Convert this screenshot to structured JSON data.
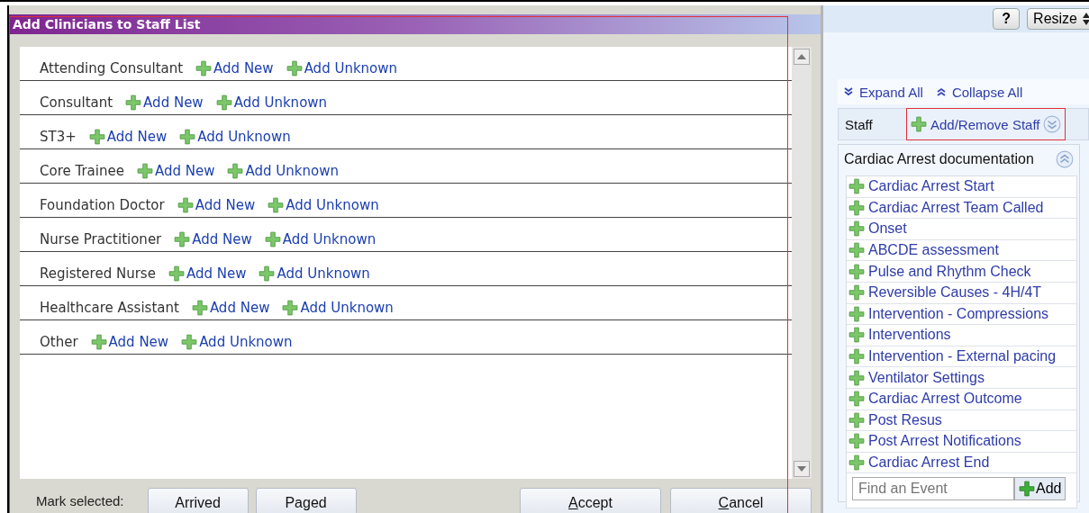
{
  "dialog": {
    "title": "Add Clinicians to Staff List",
    "roles": [
      {
        "label": "Attending Consultant",
        "actions": [
          "Add New",
          "Add Unknown"
        ]
      },
      {
        "label": "Consultant",
        "actions": [
          "Add New",
          "Add Unknown"
        ]
      },
      {
        "label": "ST3+",
        "actions": [
          "Add New",
          "Add Unknown"
        ]
      },
      {
        "label": "Core Trainee",
        "actions": [
          "Add New",
          "Add Unknown"
        ]
      },
      {
        "label": "Foundation Doctor",
        "actions": [
          "Add New",
          "Add Unknown"
        ]
      },
      {
        "label": "Nurse Practitioner",
        "actions": [
          "Add New",
          "Add Unknown"
        ]
      },
      {
        "label": "Registered Nurse",
        "actions": [
          "Add New",
          "Add Unknown"
        ]
      },
      {
        "label": "Healthcare Assistant",
        "actions": [
          "Add New",
          "Add Unknown"
        ]
      },
      {
        "label": "Other",
        "actions": [
          "Add New",
          "Add Unknown"
        ]
      }
    ],
    "footer": {
      "label": "Mark selected:",
      "mark_buttons": [
        "Arrived",
        "Paged"
      ],
      "action_buttons": [
        "Accept",
        "Cancel"
      ]
    }
  },
  "side_panel": {
    "help_button": "?",
    "resize_button": "Resize",
    "expand_all": "Expand All",
    "collapse_all": "Collapse All",
    "staff": {
      "label": "Staff",
      "action": "Add/Remove Staff"
    },
    "section": {
      "title": "Cardiac Arrest documentation",
      "events": [
        "Cardiac Arrest Start",
        "Cardiac Arrest Team Called",
        "Onset",
        "ABCDE assessment",
        "Pulse and Rhythm Check",
        "Reversible Causes - 4H/4T",
        "Intervention - Compressions",
        "Interventions",
        "Intervention - External pacing",
        "Ventilator Settings",
        "Cardiac Arrest Outcome",
        "Post Resus",
        "Post Arrest Notifications",
        "Cardiac Arrest End"
      ],
      "search": {
        "placeholder": "Find an Event"
      },
      "add_button": "Add"
    }
  }
}
